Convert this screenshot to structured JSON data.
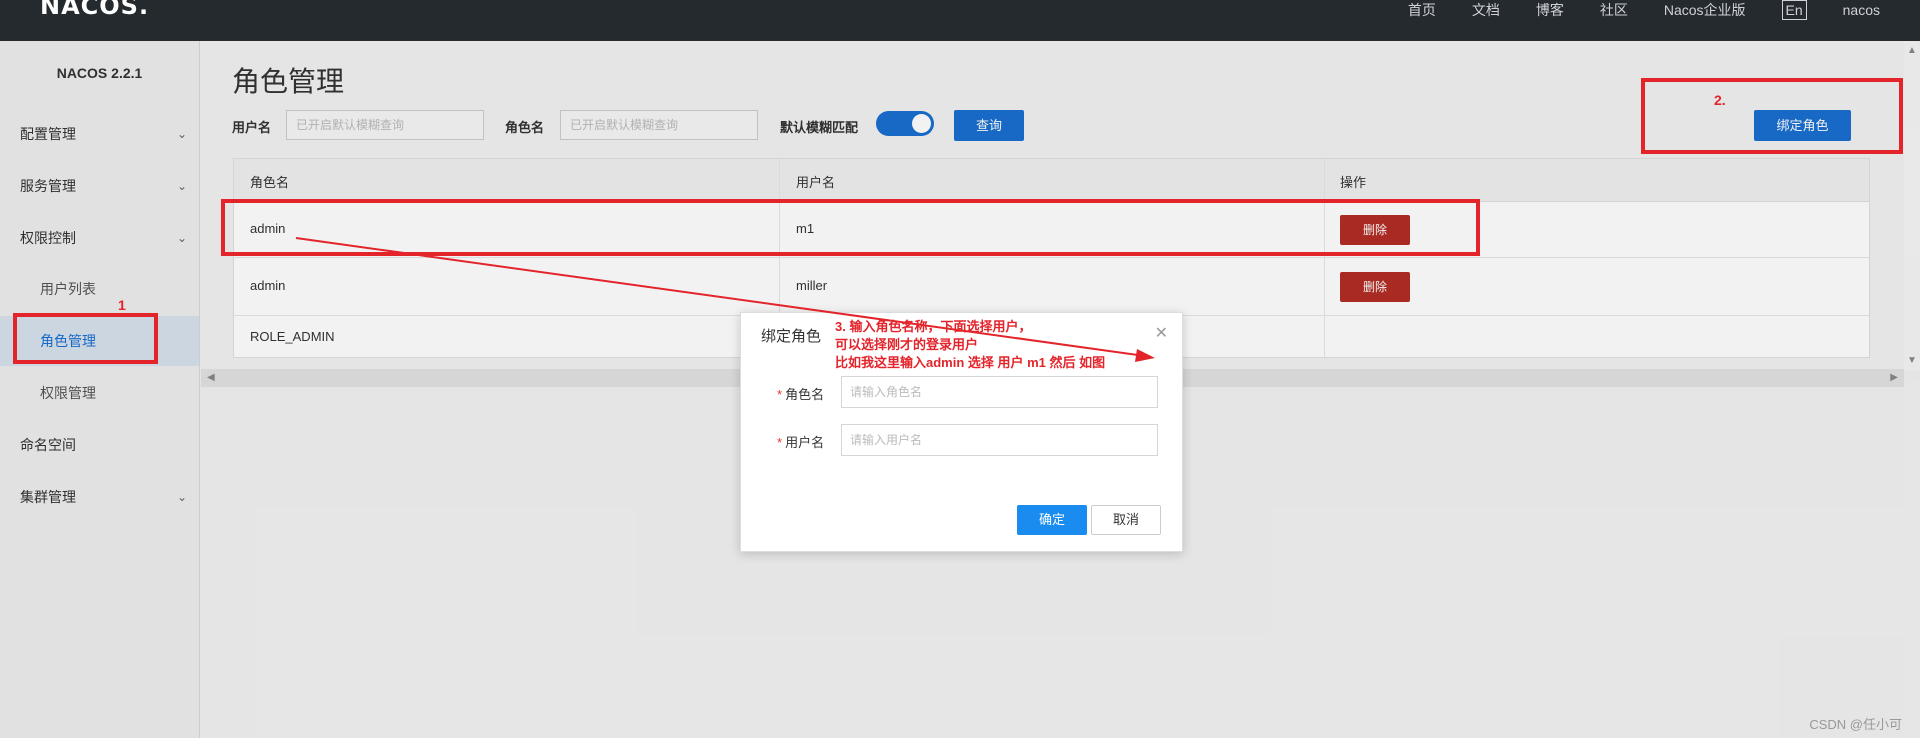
{
  "header": {
    "logo": "NACOS.",
    "nav": [
      "首页",
      "文档",
      "博客",
      "社区",
      "Nacos企业版"
    ],
    "lang": "En",
    "user": "nacos"
  },
  "sidebar": {
    "version": "NACOS 2.2.1",
    "items": [
      {
        "label": "配置管理"
      },
      {
        "label": "服务管理"
      },
      {
        "label": "权限控制"
      },
      {
        "label": "用户列表"
      },
      {
        "label": "角色管理"
      },
      {
        "label": "权限管理"
      },
      {
        "label": "命名空间"
      },
      {
        "label": "集群管理"
      }
    ]
  },
  "main": {
    "title": "角色管理",
    "filters": {
      "username_label": "用户名",
      "username_placeholder": "已开启默认模糊查询",
      "rolename_label": "角色名",
      "rolename_placeholder": "已开启默认模糊查询",
      "fuzzy_label": "默认模糊匹配",
      "fuzzy_on": true,
      "query_button": "查询"
    },
    "bind_button": "绑定角色",
    "table": {
      "headers": [
        "角色名",
        "用户名",
        "操作"
      ],
      "rows": [
        {
          "role": "admin",
          "user": "m1",
          "action": "删除"
        },
        {
          "role": "admin",
          "user": "miller",
          "action": "删除"
        },
        {
          "role": "ROLE_ADMIN",
          "user": "",
          "action": ""
        }
      ]
    }
  },
  "dialog": {
    "title": "绑定角色",
    "role_label": "角色名",
    "role_placeholder": "请输入角色名",
    "user_label": "用户名",
    "user_placeholder": "请输入用户名",
    "ok": "确定",
    "cancel": "取消"
  },
  "annotations": {
    "step1": "1",
    "step2": "2.",
    "step3_line1": "3. 输入角色名称，下面选择用户，",
    "step3_line2": "可以选择刚才的登录用户",
    "step3_line3": "比如我这里输入admin 选择 用户 m1 然后 如图",
    "color": "#e3242b"
  },
  "watermark": "CSDN @任小可",
  "colors": {
    "primary": "#1a6fd1",
    "danger": "#b22d24",
    "header": "#252a2f"
  }
}
